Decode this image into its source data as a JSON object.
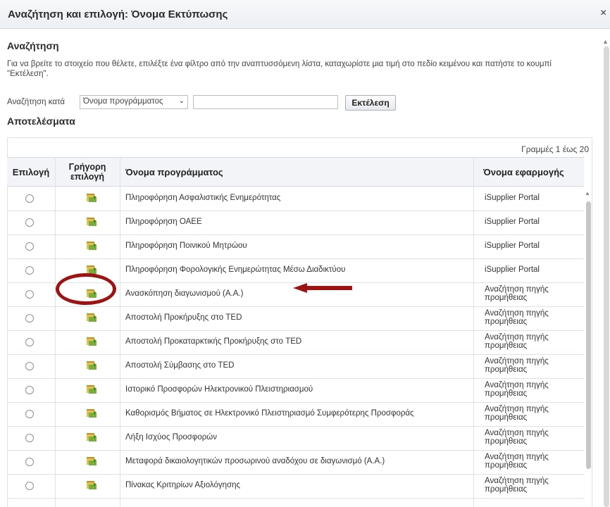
{
  "dialog": {
    "title": "Αναζήτηση και επιλογή: Όνομα Εκτύπωσης",
    "close_symbol": "×"
  },
  "search": {
    "heading": "Αναζήτηση",
    "instructions": "Για να βρείτε το στοιχείο που θέλετε, επιλέξτε ένα φίλτρο από την αναπτυσσόμενη λίστα, καταχωρίστε μια τιμή στο πεδίο κειμένου και πατήστε το κουμπί \"Εκτέλεση\".",
    "search_by_label": "Αναζήτηση κατά",
    "filter_selected": "Όνομα προγράμματος",
    "chevron_symbol": "⌄",
    "value": "",
    "go_label": "Εκτέλεση"
  },
  "results": {
    "heading": "Αποτελέσματα",
    "rows_info": "Γραμμές 1 έως 20",
    "columns": {
      "select": "Επιλογή",
      "quick_select": "Γρήγορη επιλογή",
      "program_name": "Όνομα προγράμματος",
      "application_name": "Όνομα εφαρμογής"
    },
    "rows": [
      {
        "program": "Πληροφόρηση Ασφαλιστικής Ενημερότητας",
        "application": "iSupplier Portal"
      },
      {
        "program": "Πληροφόρηση ΟΑΕΕ",
        "application": "iSupplier Portal"
      },
      {
        "program": "Πληροφόρηση Ποινικού Μητρώου",
        "application": "iSupplier Portal"
      },
      {
        "program": "Πληροφόρηση Φορολογικής Ενημερώτητας Μέσω Διαδικτύου",
        "application": "iSupplier Portal"
      },
      {
        "program": "Ανασκόπηση διαγωνισμού (Α.Α.)",
        "application": "Αναζήτηση πηγής προμήθειας"
      },
      {
        "program": "Αποστολή Προκήρυξης στο TED",
        "application": "Αναζήτηση πηγής προμήθειας"
      },
      {
        "program": "Αποστολή Προκαταρκτικής Προκήρυξης στο TED",
        "application": "Αναζήτηση πηγής προμήθειας"
      },
      {
        "program": "Αποστολή Σύμβασης στο TED",
        "application": "Αναζήτηση πηγής προμήθειας"
      },
      {
        "program": "Ιστορικό Προσφορών Ηλεκτρονικού Πλειστηριασμού",
        "application": "Αναζήτηση πηγής προμήθειας"
      },
      {
        "program": "Καθορισμός Βήματος σε Ηλεκτρονικό Πλειστηριασμό Συμφερότερης Προσφοράς",
        "application": "Αναζήτηση πηγής προμήθειας"
      },
      {
        "program": "Λήξη Ισχύος Προσφορών",
        "application": "Αναζήτηση πηγής προμήθειας"
      },
      {
        "program": "Μεταφορά δικαιολογητικών προσωρινού αναδόχου σε διαγωνισμό (Α.Α.)",
        "application": "Αναζήτηση πηγής προμήθειας"
      },
      {
        "program": "Πίνακας Κριτηρίων Αξιολόγησης",
        "application": "Αναζήτηση πηγής προμήθειας"
      }
    ]
  },
  "annotation": {
    "color": "#9c1414",
    "highlighted_row": "Ανασκόπηση διαγωνισμού (Α.Α.)"
  }
}
